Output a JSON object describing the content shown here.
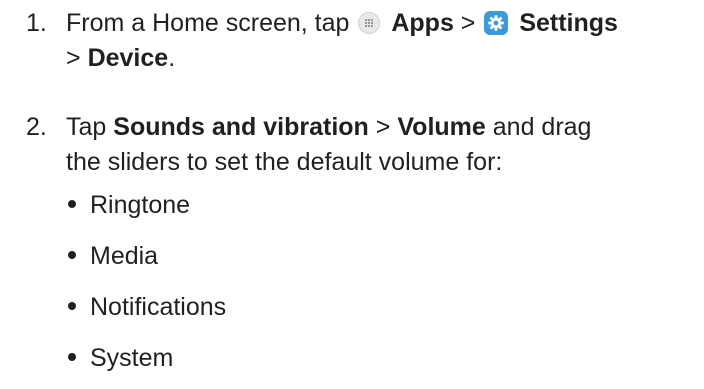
{
  "steps": [
    {
      "number": "1.",
      "text_a": "From a Home screen, tap",
      "apps_label": "Apps",
      "sep_1": ">",
      "settings_label": "Settings",
      "sep_2": ">",
      "device_label": "Device",
      "end": "."
    },
    {
      "number": "2.",
      "text_a": "Tap",
      "sounds_label": "Sounds and vibration",
      "sep_1": ">",
      "volume_label": "Volume",
      "text_b": "and drag",
      "text_c": "the sliders to set the default volume for:"
    }
  ],
  "volume_types": [
    "Ringtone",
    "Media",
    "Notifications",
    "System"
  ],
  "icons": {
    "apps": "apps-grid-icon",
    "settings": "settings-gear-icon"
  },
  "colors": {
    "text": "#231f20",
    "settings_icon_bg": "#3d9ad9",
    "apps_icon_bg": "#e9e9ea"
  }
}
